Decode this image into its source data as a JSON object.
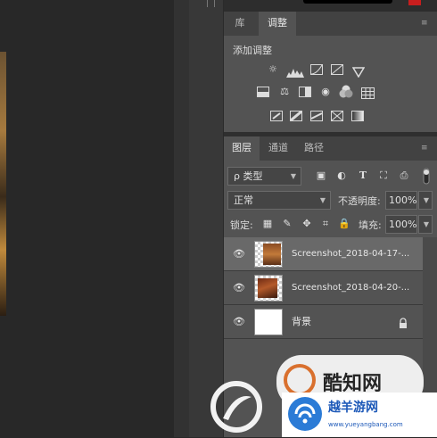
{
  "tabs_top": {
    "library": "库",
    "adjustments": "调整"
  },
  "adjustments": {
    "heading": "添加调整",
    "row1": [
      "brightness-icon",
      "levels-icon",
      "curves-icon",
      "exposure-icon",
      "vibrance-icon"
    ],
    "row2": [
      "hue-saturation-icon",
      "color-balance-icon",
      "black-white-icon",
      "photo-filter-icon",
      "channel-mixer-icon",
      "color-lookup-icon"
    ],
    "row3": [
      "invert-icon",
      "posterize-icon",
      "threshold-icon",
      "selective-color-icon",
      "gradient-map-icon"
    ]
  },
  "tabs_layers": {
    "layers": "图层",
    "channels": "通道",
    "paths": "路径"
  },
  "filter": {
    "label": "ρ 类型"
  },
  "blend": {
    "mode": "正常",
    "opacity_label": "不透明度:",
    "opacity_value": "100%",
    "lock_label": "锁定:",
    "fill_label": "填充:",
    "fill_value": "100%"
  },
  "layers": [
    {
      "name": "Screenshot_2018-04-17-...",
      "selected": true
    },
    {
      "name": "Screenshot_2018-04-20-...",
      "selected": false
    },
    {
      "name": "背景",
      "selected": false
    }
  ],
  "watermark": {
    "left": "酷知网",
    "right_title": "越羊游网",
    "right_url": "www.yueyangbang.com"
  },
  "colors": {
    "panel": "#535353",
    "selected_row": "#696969",
    "accent_red": "#c81e1e"
  }
}
